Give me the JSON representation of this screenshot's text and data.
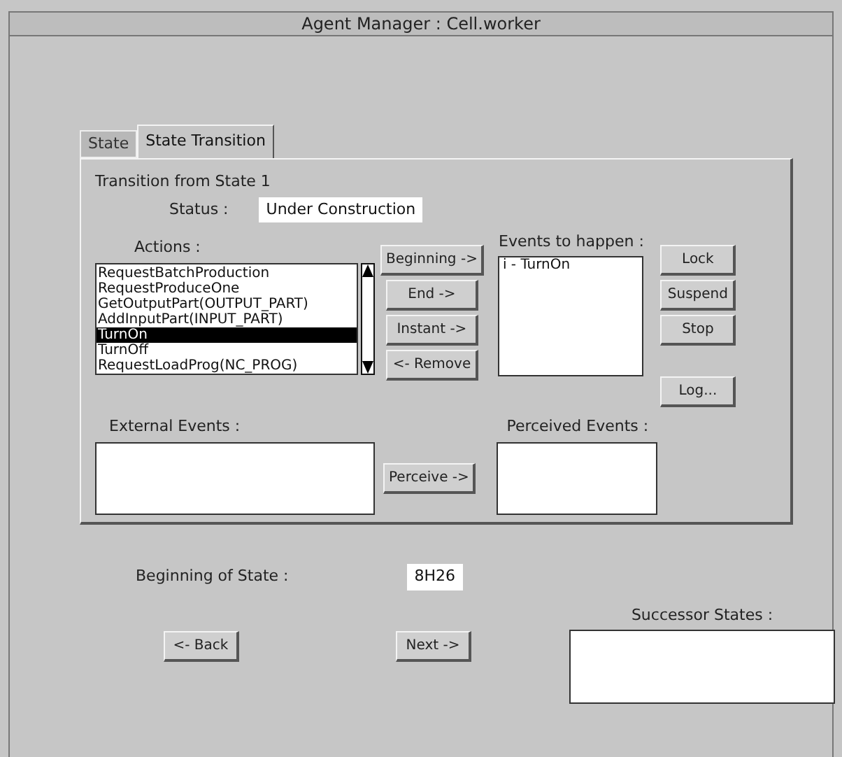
{
  "window": {
    "title": "Agent Manager : Cell.worker"
  },
  "tabs": [
    {
      "label": "State",
      "selected": false
    },
    {
      "label": "State Transition",
      "selected": true
    }
  ],
  "transition": {
    "heading": "Transition from State 1",
    "status_label": "Status :",
    "status_value": "Under Construction"
  },
  "actions": {
    "label": "Actions :",
    "items": [
      {
        "label": "RequestBatchProduction",
        "selected": false
      },
      {
        "label": "RequestProduceOne",
        "selected": false
      },
      {
        "label": "GetOutputPart(OUTPUT_PART)",
        "selected": false
      },
      {
        "label": "AddInputPart(INPUT_PART)",
        "selected": false
      },
      {
        "label": "TurnOn",
        "selected": true
      },
      {
        "label": "TurnOff",
        "selected": false
      },
      {
        "label": "RequestLoadProg(NC_PROG)",
        "selected": false
      }
    ]
  },
  "action_buttons": [
    "Beginning ->",
    "End ->",
    "Instant ->",
    "<- Remove"
  ],
  "events_to_happen": {
    "label": "Events to happen :",
    "items": [
      "i - TurnOn"
    ]
  },
  "control_buttons": [
    "Lock",
    "Suspend",
    "Stop"
  ],
  "log_button": "Log...",
  "external_events": {
    "label": "External Events :"
  },
  "perceive_button": "Perceive ->",
  "perceived_events": {
    "label": "Perceived Events :"
  },
  "beginning_of_state": {
    "label": "Beginning of State :",
    "value": "8H26"
  },
  "successor_states": {
    "label": "Successor States :"
  },
  "back_button": "<- Back",
  "next_button": "Next ->"
}
